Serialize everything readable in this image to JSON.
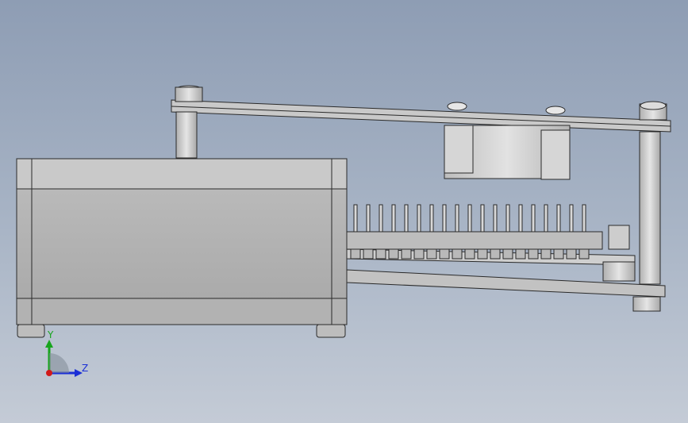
{
  "viewport": {
    "background_top": "#8e9db4",
    "background_bottom": "#c4cbd6",
    "model_color": "#c8c8c8",
    "edge_color": "#2a2a2a"
  },
  "triad": {
    "y_label": "Y",
    "z_label": "Z",
    "y_color": "#17a51d",
    "z_color": "#1b2fd6",
    "origin_color": "#d21a1a"
  },
  "parts": {
    "box_housing": "enclosure-box",
    "pcb_board": "circuit-board",
    "top_plate": "top-plate",
    "fan": "cooling-fan",
    "standoffs": "standoff-posts",
    "pin_header": "pin-header"
  }
}
